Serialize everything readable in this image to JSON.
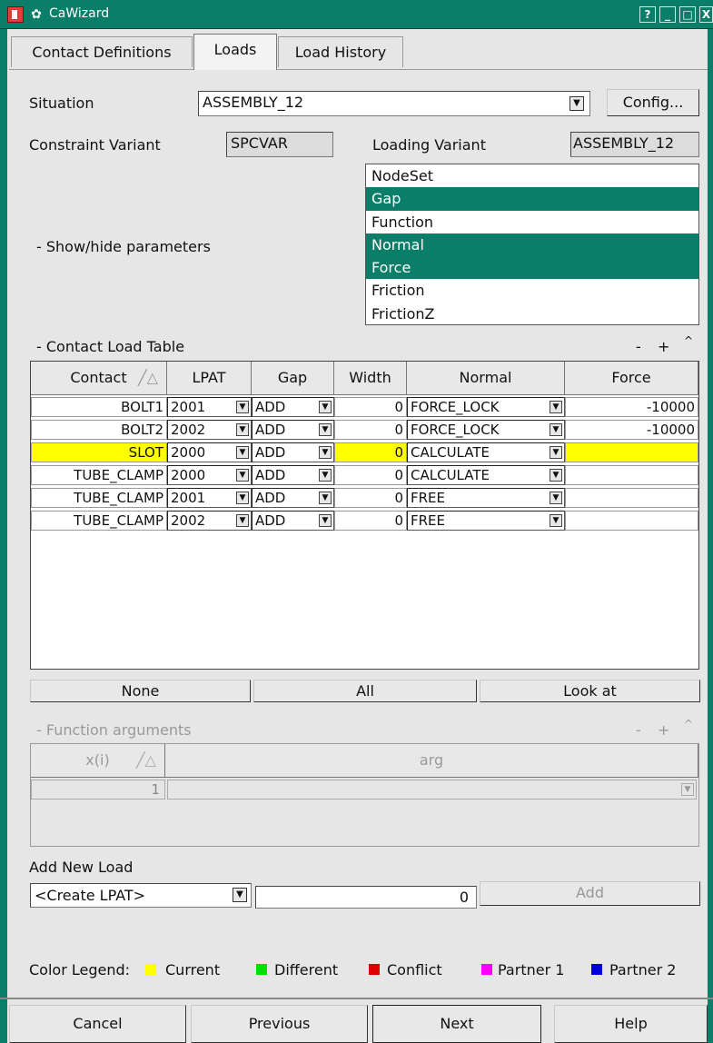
{
  "window": {
    "title": "CaWizard"
  },
  "tabs": [
    "Contact Definitions",
    "Loads",
    "Load History"
  ],
  "situation": {
    "label": "Situation",
    "value": "ASSEMBLY_12",
    "config_label": "Config..."
  },
  "constraint_variant": {
    "label": "Constraint Variant",
    "value": "SPCVAR"
  },
  "loading_variant": {
    "label": "Loading Variant",
    "value": "ASSEMBLY_12"
  },
  "params": {
    "toggle_label": "-  Show/hide parameters",
    "items": [
      {
        "label": "NodeSet",
        "selected": false
      },
      {
        "label": "Gap",
        "selected": true
      },
      {
        "label": "Function",
        "selected": false
      },
      {
        "label": "Normal",
        "selected": true
      },
      {
        "label": "Force",
        "selected": true
      },
      {
        "label": "Friction",
        "selected": false
      },
      {
        "label": "FrictionZ",
        "selected": false
      }
    ]
  },
  "contact_load_table": {
    "title": "-  Contact Load Table",
    "controls": [
      "-",
      "+",
      "^"
    ],
    "columns": [
      "Contact",
      "LPAT",
      "Gap",
      "Width",
      "Normal",
      "Force"
    ],
    "rows": [
      {
        "contact": "BOLT1",
        "lpat": "2001",
        "gap": "ADD",
        "width": "0",
        "normal": "FORCE_LOCK",
        "force": "-10000",
        "selected": false
      },
      {
        "contact": "BOLT2",
        "lpat": "2002",
        "gap": "ADD",
        "width": "0",
        "normal": "FORCE_LOCK",
        "force": "-10000",
        "selected": false
      },
      {
        "contact": "SLOT",
        "lpat": "2000",
        "gap": "ADD",
        "width": "0",
        "normal": "CALCULATE",
        "force": "",
        "selected": true
      },
      {
        "contact": "TUBE_CLAMP",
        "lpat": "2000",
        "gap": "ADD",
        "width": "0",
        "normal": "CALCULATE",
        "force": "",
        "selected": false
      },
      {
        "contact": "TUBE_CLAMP",
        "lpat": "2001",
        "gap": "ADD",
        "width": "0",
        "normal": "FREE",
        "force": "",
        "selected": false
      },
      {
        "contact": "TUBE_CLAMP",
        "lpat": "2002",
        "gap": "ADD",
        "width": "0",
        "normal": "FREE",
        "force": "",
        "selected": false
      }
    ],
    "buttons": {
      "none": "None",
      "all": "All",
      "look_at": "Look at"
    }
  },
  "function_arguments": {
    "title": "-  Function arguments",
    "controls": [
      "-",
      "+",
      "^"
    ],
    "columns": [
      "x(i)",
      "arg"
    ],
    "rows": [
      {
        "index": "1",
        "arg": ""
      }
    ]
  },
  "add_new_load": {
    "label": "Add New Load",
    "select_value": "<Create LPAT>",
    "value": "0",
    "add_label": "Add"
  },
  "legend": {
    "label": "Color Legend:",
    "items": [
      {
        "label": "Current",
        "color": "#ffff00"
      },
      {
        "label": "Different",
        "color": "#00e000"
      },
      {
        "label": "Conflict",
        "color": "#e00000"
      },
      {
        "label": "Partner 1",
        "color": "#ff00ff"
      },
      {
        "label": "Partner 2",
        "color": "#0000e0"
      }
    ]
  },
  "footer": {
    "cancel": "Cancel",
    "previous": "Previous",
    "next": "Next",
    "help": "Help"
  }
}
